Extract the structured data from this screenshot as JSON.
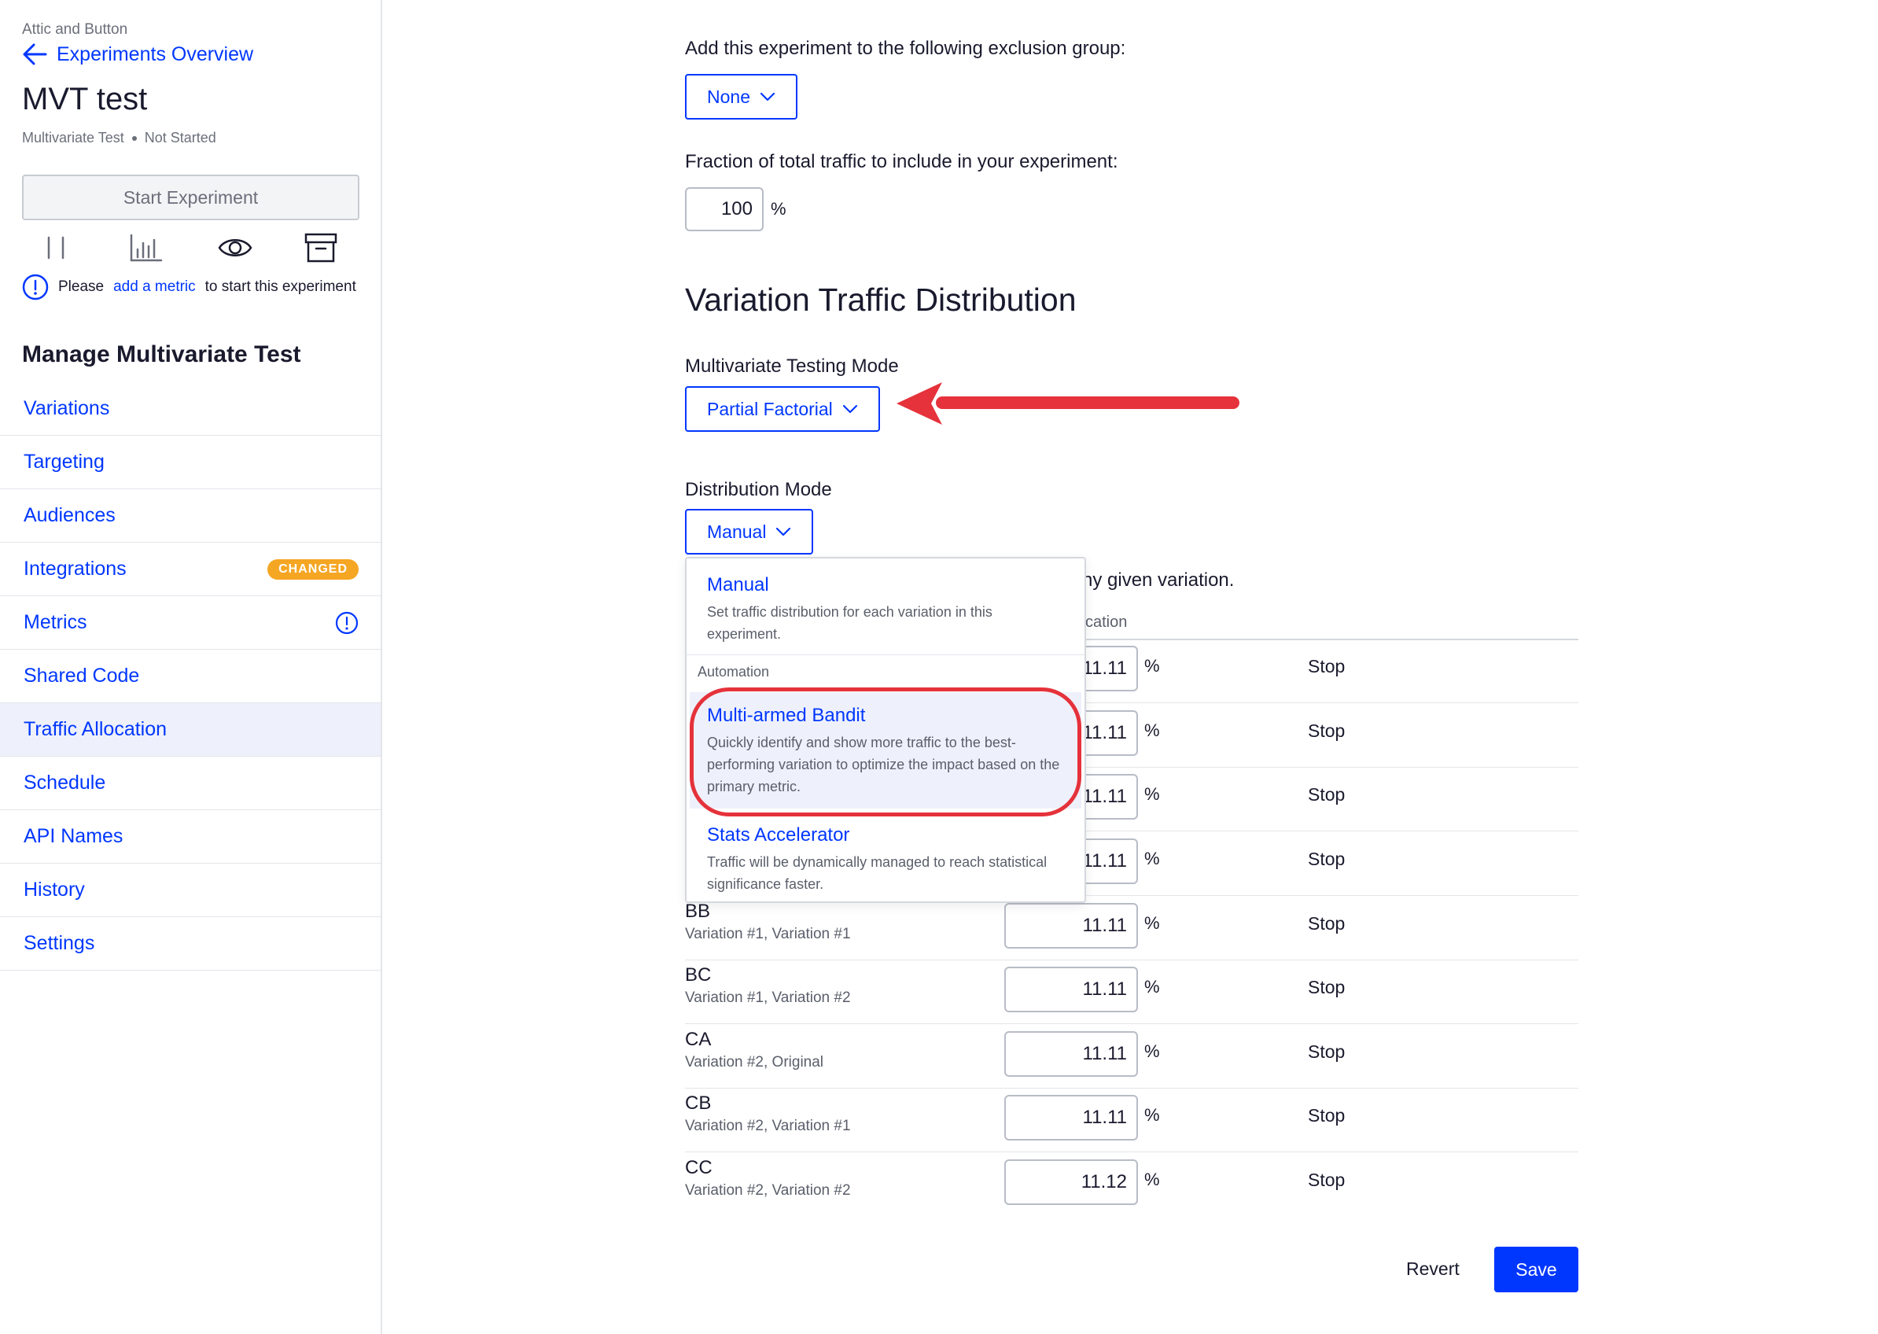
{
  "sidebar": {
    "project_name": "Attic and Button",
    "back_link": "Experiments Overview",
    "experiment_title": "MVT test",
    "experiment_type": "Multivariate Test",
    "experiment_status": "Not Started",
    "start_button": "Start Experiment",
    "warning": {
      "prefix": "Please",
      "link": "add a metric",
      "suffix": "to start this experiment"
    },
    "manage_title": "Manage Multivariate Test",
    "nav": [
      {
        "label": "Variations"
      },
      {
        "label": "Targeting"
      },
      {
        "label": "Audiences"
      },
      {
        "label": "Integrations",
        "badge": "CHANGED"
      },
      {
        "label": "Metrics"
      },
      {
        "label": "Shared Code"
      },
      {
        "label": "Traffic Allocation",
        "active": true
      },
      {
        "label": "Schedule"
      },
      {
        "label": "API Names"
      },
      {
        "label": "History"
      },
      {
        "label": "Settings"
      }
    ]
  },
  "main": {
    "exclusion_label": "Add this experiment to the following exclusion group:",
    "exclusion_value": "None",
    "fraction_label": "Fraction of total traffic to include in your experiment:",
    "fraction_value": "100",
    "fraction_unit": "%",
    "section_title": "Variation Traffic Distribution",
    "mvt_mode_label": "Multivariate Testing Mode",
    "mvt_mode_value": "Partial Factorial",
    "distribution_label": "Distribution Mode",
    "distribution_value": "Manual",
    "description_fragment": "ny given variation.",
    "column_header_fragment": "cation",
    "rows": [
      {
        "name": "",
        "sub": "",
        "value": "11.11",
        "unit": "%",
        "action": "Stop"
      },
      {
        "name": "",
        "sub": "",
        "value": "11.11",
        "unit": "%",
        "action": "Stop"
      },
      {
        "name": "",
        "sub": "",
        "value": "11.11",
        "unit": "%",
        "action": "Stop"
      },
      {
        "name": "",
        "sub": "",
        "value": "11.11",
        "unit": "%",
        "action": "Stop"
      },
      {
        "name": "BB",
        "sub": "Variation #1, Variation #1",
        "value": "11.11",
        "unit": "%",
        "action": "Stop"
      },
      {
        "name": "BC",
        "sub": "Variation #1, Variation #2",
        "value": "11.11",
        "unit": "%",
        "action": "Stop"
      },
      {
        "name": "CA",
        "sub": "Variation #2, Original",
        "value": "11.11",
        "unit": "%",
        "action": "Stop"
      },
      {
        "name": "CB",
        "sub": "Variation #2, Variation #1",
        "value": "11.11",
        "unit": "%",
        "action": "Stop"
      },
      {
        "name": "CC",
        "sub": "Variation #2, Variation #2",
        "value": "11.12",
        "unit": "%",
        "action": "Stop"
      }
    ],
    "revert_button": "Revert",
    "save_button": "Save"
  },
  "distribution_menu": {
    "manual": {
      "title": "Manual",
      "description": "Set traffic distribution for each variation in this experiment."
    },
    "group_label": "Automation",
    "bandit": {
      "title": "Multi-armed Bandit",
      "description": "Quickly identify and show more traffic to the best-performing variation to optimize the impact based on the primary metric."
    },
    "stats": {
      "title": "Stats Accelerator",
      "description": "Traffic will be dynamically managed to reach statistical significance faster."
    }
  },
  "colors": {
    "brand_blue": "#0037ff",
    "badge_orange": "#f5a623",
    "annotation_red": "#e5323b",
    "active_nav_bg": "#eef1fb"
  },
  "icons": [
    "arrow-left-icon",
    "pause-icon",
    "bar-chart-icon",
    "eye-icon",
    "archive-icon",
    "info-circle-icon",
    "chevron-down-icon"
  ]
}
